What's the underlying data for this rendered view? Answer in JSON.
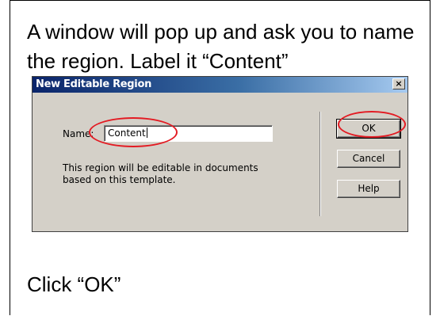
{
  "instruction": {
    "text": "A window will pop up and ask you to name the region.  Label it “Content”"
  },
  "dialog": {
    "title": "New Editable Region",
    "close_glyph": "×",
    "name_label": "Name:",
    "name_value": "Content",
    "description": "This region will be editable in documents based on this template.",
    "buttons": {
      "ok": "OK",
      "cancel": "Cancel",
      "help": "Help"
    }
  },
  "caption": {
    "text": "Click “OK”"
  },
  "colors": {
    "annotation": "#e31b23",
    "dialog_bg": "#d4d0c8",
    "titlebar_start": "#0a246a",
    "titlebar_end": "#a6caf0"
  },
  "icons": {
    "close": "close-icon"
  }
}
